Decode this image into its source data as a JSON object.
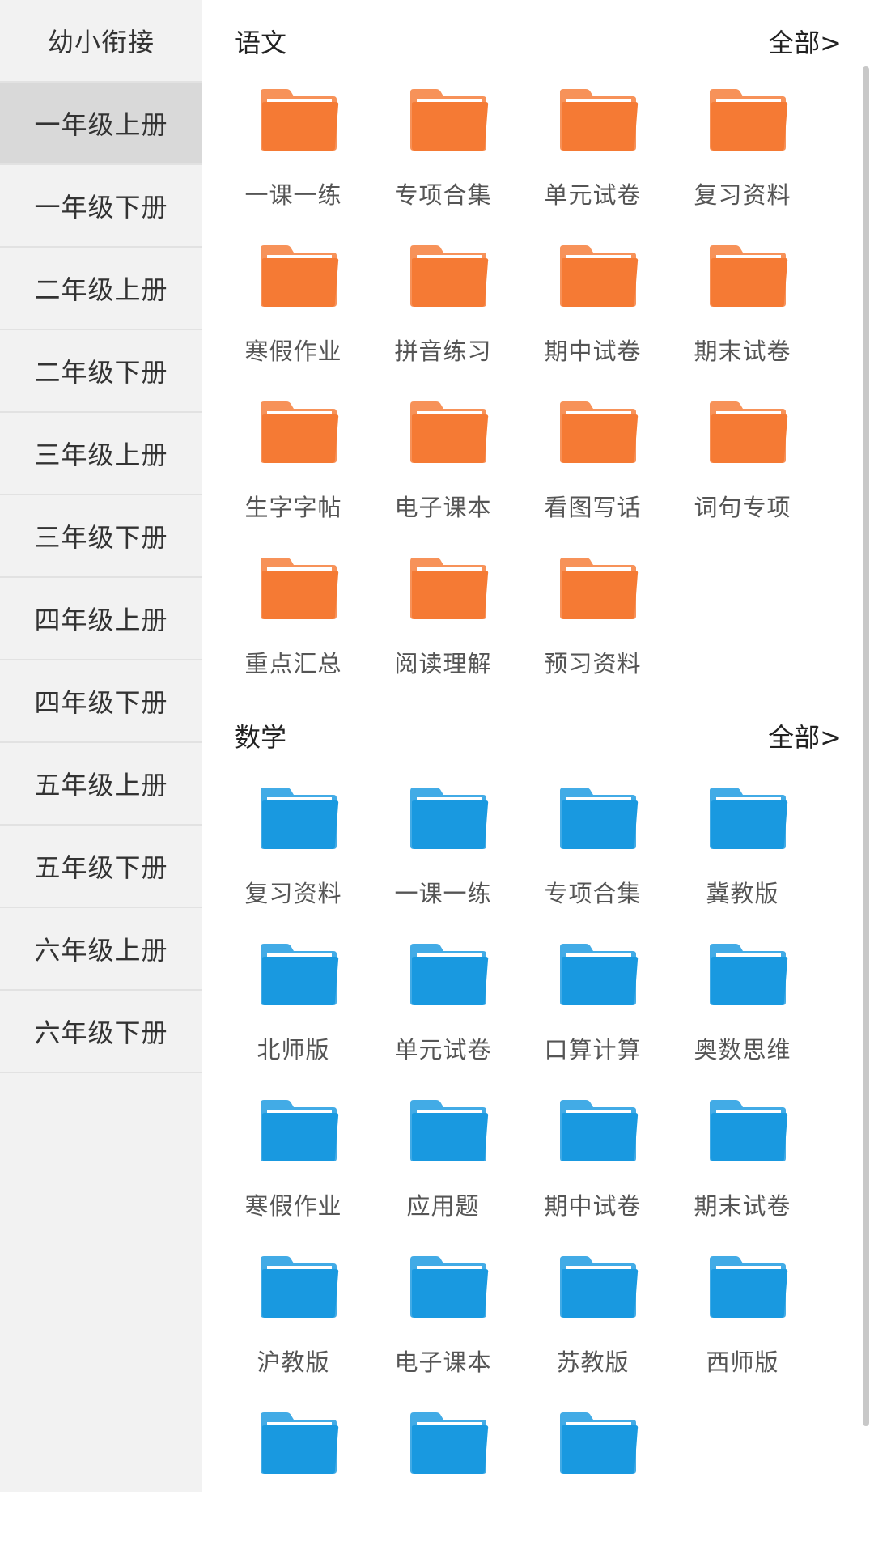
{
  "colors": {
    "chinese_folder": "#f57a34",
    "math_folder": "#1999e0",
    "sidebar_bg": "#f2f2f2",
    "sidebar_active": "#d9d9d9"
  },
  "sidebar": {
    "items": [
      {
        "label": "幼小衔接",
        "active": false
      },
      {
        "label": "一年级上册",
        "active": true
      },
      {
        "label": "一年级下册",
        "active": false
      },
      {
        "label": "二年级上册",
        "active": false
      },
      {
        "label": "二年级下册",
        "active": false
      },
      {
        "label": "三年级上册",
        "active": false
      },
      {
        "label": "三年级下册",
        "active": false
      },
      {
        "label": "四年级上册",
        "active": false
      },
      {
        "label": "四年级下册",
        "active": false
      },
      {
        "label": "五年级上册",
        "active": false
      },
      {
        "label": "五年级下册",
        "active": false
      },
      {
        "label": "六年级上册",
        "active": false
      },
      {
        "label": "六年级下册",
        "active": false
      }
    ]
  },
  "sections": [
    {
      "title": "语文",
      "all_label": "全部>",
      "icon": "folder-icon",
      "folders": [
        "一课一练",
        "专项合集",
        "单元试卷",
        "复习资料",
        "寒假作业",
        "拼音练习",
        "期中试卷",
        "期末试卷",
        "生字字帖",
        "电子课本",
        "看图写话",
        "词句专项",
        "重点汇总",
        "阅读理解",
        "预习资料"
      ]
    },
    {
      "title": "数学",
      "all_label": "全部>",
      "icon": "folder-icon",
      "folders": [
        "复习资料",
        "一课一练",
        "专项合集",
        "冀教版",
        "北师版",
        "单元试卷",
        "口算计算",
        "奥数思维",
        "寒假作业",
        "应用题",
        "期中试卷",
        "期末试卷",
        "沪教版",
        "电子课本",
        "苏教版",
        "西师版",
        "",
        "",
        ""
      ]
    }
  ]
}
